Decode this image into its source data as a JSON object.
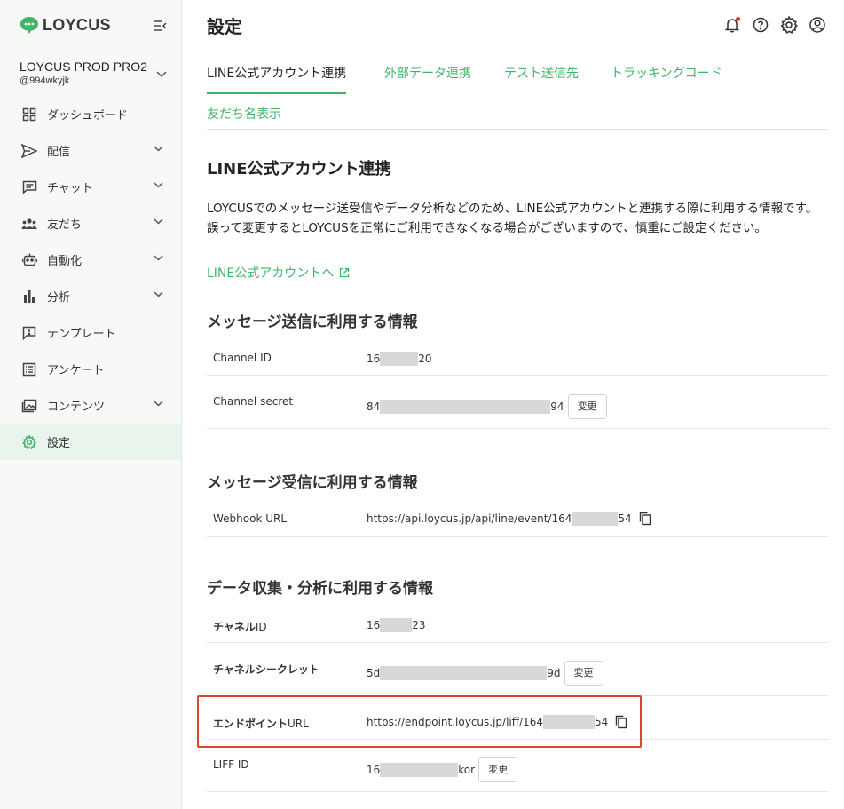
{
  "app": {
    "logo_text": "LOYCUS"
  },
  "account": {
    "name": "LOYCUS PROD PRO2",
    "handle": "@994wkyjk"
  },
  "sidebar": {
    "items": [
      {
        "label": "ダッシュボード",
        "icon": "dashboard-icon"
      },
      {
        "label": "配信",
        "icon": "send-icon"
      },
      {
        "label": "チャット",
        "icon": "chat-icon"
      },
      {
        "label": "友だち",
        "icon": "friends-icon"
      },
      {
        "label": "自動化",
        "icon": "robot-icon"
      },
      {
        "label": "分析",
        "icon": "bar-chart-icon"
      },
      {
        "label": "テンプレート",
        "icon": "template-icon"
      },
      {
        "label": "アンケート",
        "icon": "survey-icon"
      },
      {
        "label": "コンテンツ",
        "icon": "image-icon"
      },
      {
        "label": "設定",
        "icon": "gear-icon",
        "active": true
      }
    ]
  },
  "header": {
    "title": "設定"
  },
  "tabs": [
    {
      "label": "LINE公式アカウント連携",
      "active": true
    },
    {
      "label": "外部データ連携"
    },
    {
      "label": "テスト送信先"
    },
    {
      "label": "トラッキングコード"
    },
    {
      "label": "友だち名表示"
    }
  ],
  "main": {
    "section_title": "LINE公式アカウント連携",
    "description_line1": "LOYCUSでのメッセージ送受信やデータ分析などのため、LINE公式アカウントと連携する際に利用する情報です。",
    "description_line2": "誤って変更するとLOYCUSを正常にご利用できなくなる場合がございますので、慎重にご設定ください。",
    "external_link": "LINE公式アカウントへ",
    "change_label": "変更",
    "groups": {
      "send": {
        "title": "メッセージ送信に利用する情報",
        "channel_id": {
          "label": "Channel ID",
          "prefix": "16",
          "suffix": "20"
        },
        "channel_secret": {
          "label": "Channel secret",
          "prefix": "84",
          "suffix": "94"
        }
      },
      "receive": {
        "title": "メッセージ受信に利用する情報",
        "webhook": {
          "label": "Webhook URL",
          "prefix": "https://api.loycus.jp/api/line/event/164",
          "suffix": "54"
        }
      },
      "analytics": {
        "title": "データ収集・分析に利用する情報",
        "channel_id": {
          "label_bold": "チャネル",
          "label_rest": "ID",
          "prefix": "16",
          "suffix": "23"
        },
        "channel_secret": {
          "label": "チャネルシークレット",
          "prefix": "5d",
          "suffix": "9d"
        },
        "endpoint": {
          "label_bold": "エンドポイント",
          "label_rest": "URL",
          "prefix": "https://endpoint.loycus.jp/liff/164",
          "suffix": "54"
        },
        "liff": {
          "label": "LIFF ID",
          "prefix": "16",
          "suffix": "kor"
        }
      }
    }
  },
  "colors": {
    "accent": "#3fb56a",
    "highlight": "#d9452e",
    "sidebar_active_bg": "#e8f4ec"
  }
}
